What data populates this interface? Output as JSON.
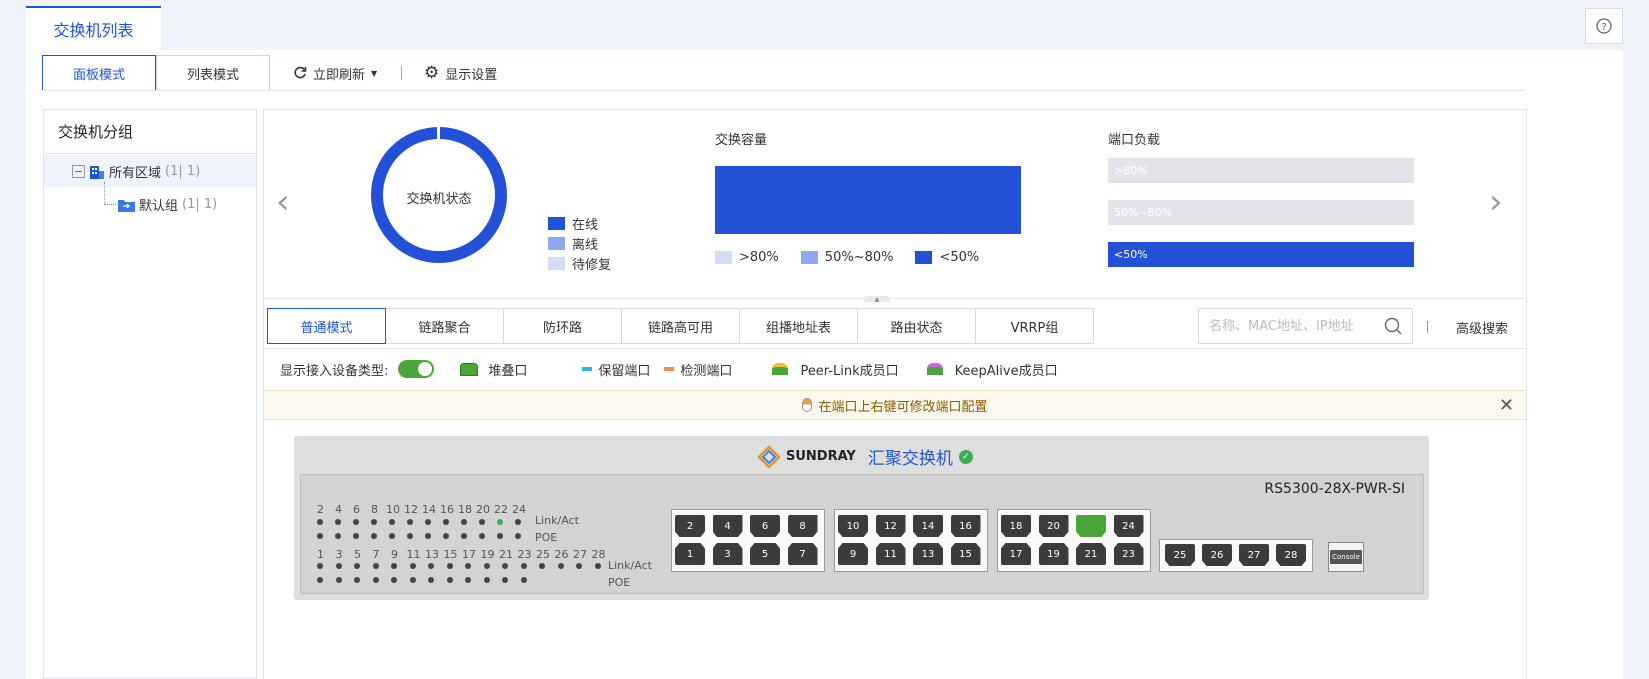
{
  "header": {
    "main_tab": "交换机列表"
  },
  "toolbar": {
    "mode_panel": "面板模式",
    "mode_list": "列表模式",
    "refresh": "立即刷新",
    "display_settings": "显示设置"
  },
  "sidebar": {
    "title": "交换机分组",
    "items": [
      {
        "label": "所有区域",
        "count": "(1| 1)"
      },
      {
        "label": "默认组",
        "count": "(1| 1)"
      }
    ]
  },
  "summary": {
    "status_title": "交换机状态",
    "status_legend": [
      {
        "label": "在线",
        "color": "#2251d8"
      },
      {
        "label": "离线",
        "color": "#8fa9ee"
      },
      {
        "label": "待修复",
        "color": "#d3dcf6"
      }
    ],
    "status_values": {
      "online": 1,
      "offline": 0,
      "repair": 0
    },
    "capacity_title": "交换容量",
    "capacity_legend": [
      {
        "label": ">80%",
        "color": "#d3dcf6"
      },
      {
        "label": "50%~80%",
        "color": "#8fa9ee"
      },
      {
        "label": "<50%",
        "color": "#2251d8"
      }
    ],
    "port_load_title": "端口负载",
    "port_load_bars": [
      {
        "label": ">80%",
        "level": 0
      },
      {
        "label": "50%~80%",
        "level": 0
      },
      {
        "label": "<50%",
        "level": 1
      }
    ]
  },
  "subtabs": [
    "普通模式",
    "链路聚合",
    "防环路",
    "链路高可用",
    "组播地址表",
    "路由状态",
    "VRRP组"
  ],
  "search": {
    "placeholder": "名称、MAC地址、IP地址",
    "advanced": "高级搜索"
  },
  "options": {
    "show_device_type": "显示接入设备类型:",
    "legend": [
      {
        "label": "堆叠口",
        "icon": "stack-port-icon"
      },
      {
        "label": "保留端口",
        "icon": "reserved-port-icon",
        "color": "#2ab7e0"
      },
      {
        "label": "检测端口",
        "icon": "detect-port-icon",
        "color": "#f08a5d"
      },
      {
        "label": "Peer-Link成员口",
        "icon": "peer-link-icon"
      },
      {
        "label": "KeepAlive成员口",
        "icon": "keepalive-icon"
      }
    ]
  },
  "notice": "在端口上右键可修改端口配置",
  "device": {
    "brand": "SUNDRAY",
    "name": "汇聚交换机",
    "model": "RS5300-28X-PWR-SI",
    "led_link": "Link/Act",
    "led_poe": "POE",
    "even_labels": [
      "2",
      "4",
      "6",
      "8",
      "10",
      "12",
      "14",
      "16",
      "18",
      "20",
      "22",
      "24"
    ],
    "odd_labels": [
      "1",
      "3",
      "5",
      "7",
      "9",
      "11",
      "13",
      "15",
      "17",
      "19",
      "21",
      "23",
      "25",
      "26",
      "27",
      "28"
    ],
    "console": "Console",
    "active_port": "22"
  }
}
